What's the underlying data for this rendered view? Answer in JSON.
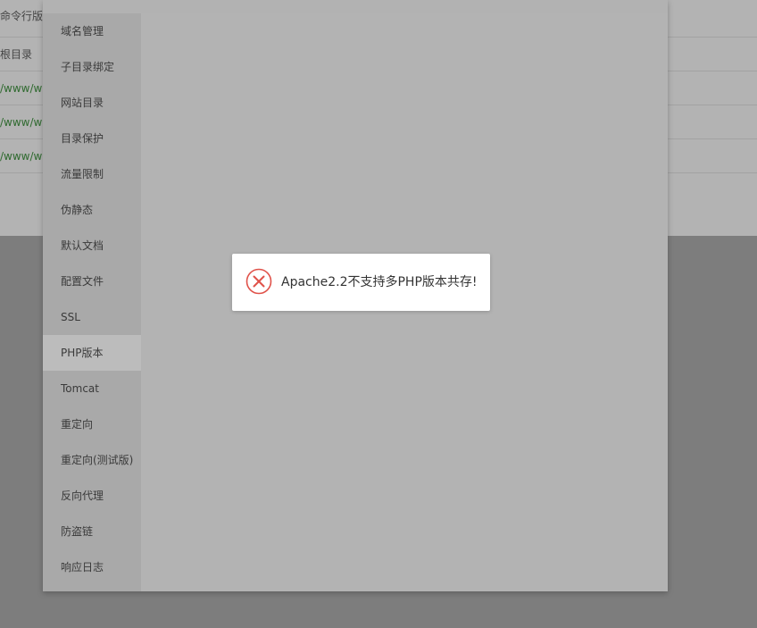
{
  "background": {
    "rows": [
      {
        "text": "命令行版"
      },
      {
        "text": "根目录"
      },
      {
        "text": "/www/w"
      },
      {
        "text": "/www/w"
      },
      {
        "text": "/www/w"
      }
    ]
  },
  "sidebar": {
    "items": [
      {
        "label": "域名管理"
      },
      {
        "label": "子目录绑定"
      },
      {
        "label": "网站目录"
      },
      {
        "label": "目录保护"
      },
      {
        "label": "流量限制"
      },
      {
        "label": "伪静态"
      },
      {
        "label": "默认文档"
      },
      {
        "label": "配置文件"
      },
      {
        "label": "SSL"
      },
      {
        "label": "PHP版本"
      },
      {
        "label": "Tomcat"
      },
      {
        "label": "重定向"
      },
      {
        "label": "重定向(测试版)"
      },
      {
        "label": "反向代理"
      },
      {
        "label": "防盗链"
      },
      {
        "label": "响应日志"
      }
    ],
    "active_index": 9
  },
  "toast": {
    "icon": "error-circle-icon",
    "icon_color": "#e0524a",
    "message": "Apache2.2不支持多PHP版本共存!"
  }
}
